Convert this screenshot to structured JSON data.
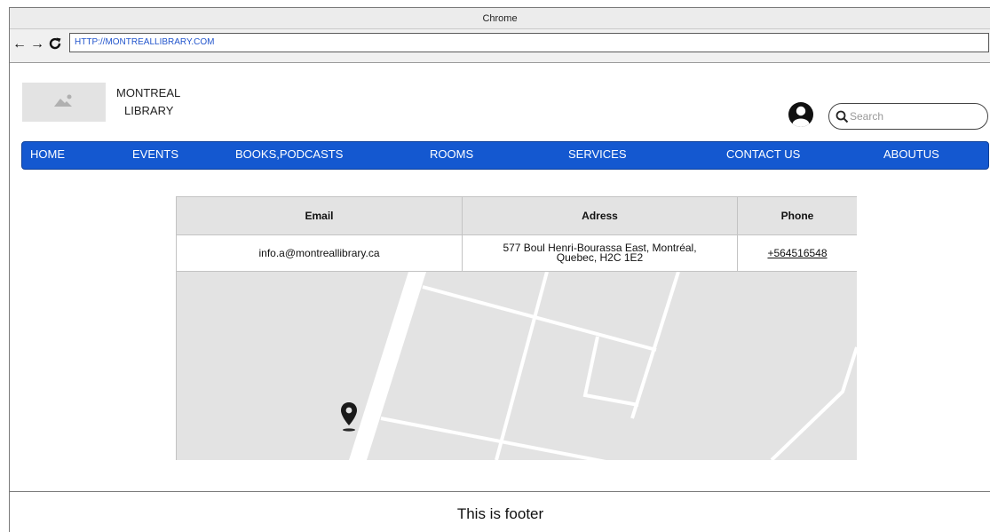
{
  "browser": {
    "title": "Chrome",
    "url": "HTTP://MONTREALLIBRARY.COM",
    "back_icon": "←",
    "forward_icon": "→"
  },
  "header": {
    "logo_line1": "MONTREAL",
    "logo_line2": "LIBRARY",
    "search_placeholder": "Search"
  },
  "nav": {
    "items": [
      "HOME",
      "EVENTS",
      "BOOKS,PODCASTS",
      "ROOMS",
      "SERVICES",
      "CONTACT US",
      "ABOUTUS"
    ]
  },
  "contact": {
    "headers": [
      "Email",
      "Adress",
      "Phone"
    ],
    "email": "info.a@montreallibrary.ca",
    "address_line1": "577 Boul Henri-Bourassa East, Montréal,",
    "address_line2": "Quebec, H2C 1E2",
    "phone": "+564516548"
  },
  "footer": {
    "text": "This is footer"
  },
  "colors": {
    "nav_bg": "#1458d0",
    "header_bg": "#e3e3e3",
    "map_bg": "#e3e3e3"
  }
}
